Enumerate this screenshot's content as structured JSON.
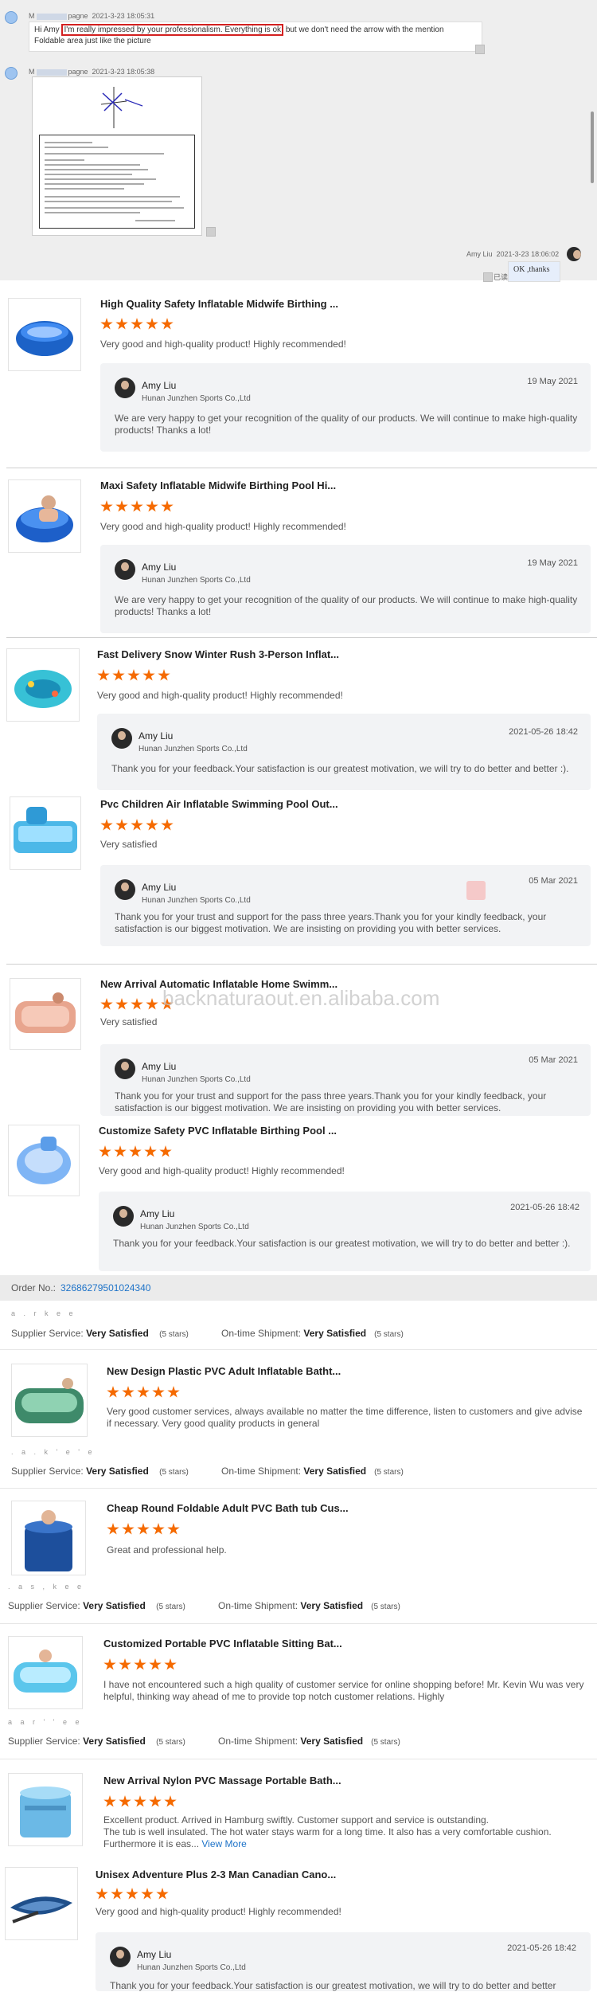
{
  "chat": {
    "msg1": {
      "sender_suffix": "pagne",
      "sender_prefix": "M",
      "time": "2021-3-23 18:05:31",
      "text_start": "Hi Amy",
      "text_highlight": "I'm really impressed by your professionalism. Everything is ok",
      "text_end": "but we don't need the arrow with the mention",
      "text_line2": "Foldable area just like the picture"
    },
    "msg2": {
      "sender_prefix": "M",
      "sender_suffix": "pagne",
      "time": "2021-3-23 18:05:38"
    },
    "reply": {
      "sender": "Amy Liu",
      "time": "2021-3-23 18:06:02",
      "text": "OK ,thanks",
      "read_label": "已读"
    }
  },
  "reviews": [
    {
      "title": "High Quality Safety Inflatable Midwife Birthing ...",
      "rating": 5,
      "text": "Very good and high-quality product! Highly recommended!",
      "reply": {
        "name": "Amy Liu",
        "company": "Hunan Junzhen Sports Co.,Ltd",
        "date": "19 May 2021",
        "text": "We are very happy to get your recognition of the quality of our products. We will continue to make high-quality products! Thanks a lot!"
      }
    },
    {
      "title": "Maxi Safety Inflatable Midwife Birthing Pool Hi...",
      "rating": 5,
      "text": "Very good and high-quality product! Highly recommended!",
      "reply": {
        "name": "Amy Liu",
        "company": "Hunan Junzhen Sports Co.,Ltd",
        "date": "19 May 2021",
        "text": "We are very happy to get your recognition of the quality of our products. We will continue to make high-quality products! Thanks a lot!"
      }
    },
    {
      "title": "Fast Delivery Snow Winter Rush 3-Person Inflat...",
      "rating": 5,
      "text": "Very good and high-quality product! Highly recommended!",
      "reply": {
        "name": "Amy Liu",
        "company": "Hunan Junzhen Sports Co.,Ltd",
        "date": "2021-05-26 18:42",
        "text": "Thank you for your feedback.Your satisfaction is our greatest motivation, we will try to do better and better :)."
      }
    },
    {
      "title": "Pvc Children Air Inflatable Swimming Pool Out...",
      "rating": 5,
      "text": "Very satisfied",
      "reply": {
        "name": "Amy Liu",
        "company": "Hunan Junzhen Sports Co.,Ltd",
        "date": "05 Mar 2021",
        "text": "Thank you for your trust and support for the pass three years.Thank you for your kindly feedback, your satisfaction is our biggest motivation. We are insisting on providing you with better services."
      }
    },
    {
      "title": "New Arrival Automatic Inflatable Home Swimm...",
      "rating": 5,
      "text": "Very satisfied",
      "reply": {
        "name": "Amy Liu",
        "company": "Hunan Junzhen Sports Co.,Ltd",
        "date": "05 Mar 2021",
        "text": "Thank you for your trust and support for the pass three years.Thank you for your kindly feedback, your satisfaction is our biggest motivation. We are insisting on providing you with better services."
      }
    },
    {
      "title": "Customize Safety PVC Inflatable Birthing Pool ...",
      "rating": 5,
      "text": "Very good and high-quality product! Highly recommended!",
      "reply": {
        "name": "Amy Liu",
        "company": "Hunan Junzhen Sports Co.,Ltd",
        "date": "2021-05-26 18:42",
        "text": "Thank you for your feedback.Your satisfaction is our greatest motivation, we will try to do better and better :)."
      }
    }
  ],
  "watermark": "backnaturaout.en.alibaba.com",
  "order": {
    "label": "Order No.:",
    "number": "32686279501024340"
  },
  "service_labels": {
    "supplier": "Supplier Service:",
    "shipment": "On-time Shipment:",
    "value": "Very Satisfied",
    "stars": "(5 stars)"
  },
  "order_reviews": [
    {
      "title": "New Design Plastic PVC Adult Inflatable Batht...",
      "rating": 5,
      "text": "Very good customer services, always available no matter the time difference, listen to customers and give advise if necessary. Very good quality products in general"
    },
    {
      "title": "Cheap Round Foldable Adult PVC Bath tub Cus...",
      "rating": 5,
      "text": "Great and professional help."
    },
    {
      "title": "Customized Portable PVC Inflatable Sitting Bat...",
      "rating": 5,
      "text": "I have not encountered such a high quality of customer service for online shopping before!  Mr. Kevin Wu was very helpful, thinking way ahead of me to provide top notch customer relations.  Highly"
    },
    {
      "title": "New Arrival Nylon PVC Massage Portable Bath...",
      "rating": 5,
      "text_l1": "Excellent product. Arrived in Hamburg swiftly. Customer support and service is outstanding.",
      "text_l2": "The tub is well insulated. The hot water stays warm for a long time. It also has a very comfortable cushion.",
      "text_l3": "Furthermore it is eas...",
      "view_more": "View More"
    },
    {
      "title": "Unisex Adventure Plus 2-3 Man Canadian Cano...",
      "rating": 5,
      "text": "Very good and high-quality product! Highly recommended!",
      "reply": {
        "name": "Amy Liu",
        "company": "Hunan Junzhen Sports Co.,Ltd",
        "date": "2021-05-26 18:42",
        "text": "Thank you for your feedback.Your satisfaction is our greatest motivation, we will try to do better and better"
      }
    }
  ],
  "colors": {
    "star": "#f56a00",
    "link": "#1e73c8",
    "highlight": "#d32020"
  }
}
